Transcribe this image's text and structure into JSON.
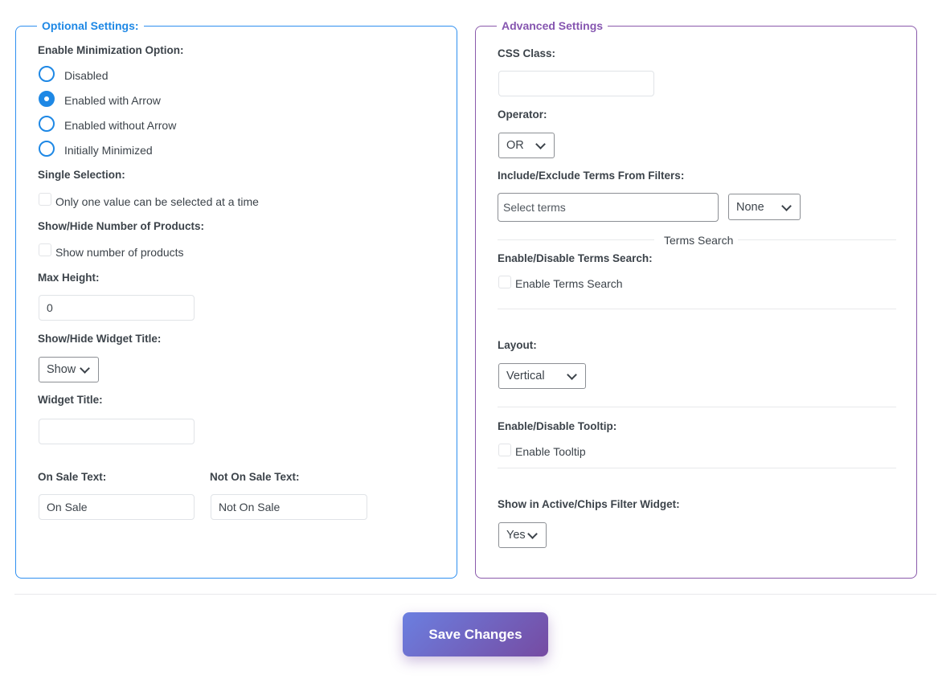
{
  "optional": {
    "legend": "Optional Settings:",
    "minimization_label": "Enable Minimization Option:",
    "minimization_options": [
      "Disabled",
      "Enabled with Arrow",
      "Enabled without Arrow",
      "Initially Minimized"
    ],
    "minimization_selected": "Enabled with Arrow",
    "single_selection_label": "Single Selection:",
    "single_selection_checkbox": "Only one value can be selected at a time",
    "show_products_label": "Show/Hide Number of Products:",
    "show_products_checkbox": "Show number of products",
    "max_height_label": "Max Height:",
    "max_height_value": "0",
    "widget_title_toggle_label": "Show/Hide Widget Title:",
    "widget_title_toggle_value": "Show",
    "widget_title_label": "Widget Title:",
    "widget_title_value": "",
    "on_sale_label": "On Sale Text:",
    "on_sale_value": "On Sale",
    "not_on_sale_label": "Not On Sale Text:",
    "not_on_sale_value": "Not On Sale"
  },
  "advanced": {
    "legend": "Advanced Settings",
    "css_class_label": "CSS Class:",
    "css_class_value": "",
    "operator_label": "Operator:",
    "operator_value": "OR",
    "terms_label": "Include/Exclude Terms From Filters:",
    "terms_placeholder": "Select terms",
    "terms_mode_value": "None",
    "terms_search_divider": "Terms Search",
    "terms_search_label": "Enable/Disable Terms Search:",
    "terms_search_checkbox": "Enable Terms Search",
    "layout_label": "Layout:",
    "layout_value": "Vertical",
    "tooltip_label": "Enable/Disable Tooltip:",
    "tooltip_checkbox": "Enable Tooltip",
    "chips_label": "Show in Active/Chips Filter Widget:",
    "chips_value": "Yes"
  },
  "save_label": "Save Changes",
  "colors": {
    "optional_accent": "#1e88e5",
    "advanced_accent": "#8656b0",
    "button_start": "#6b7fe0",
    "button_end": "#764ba2"
  }
}
